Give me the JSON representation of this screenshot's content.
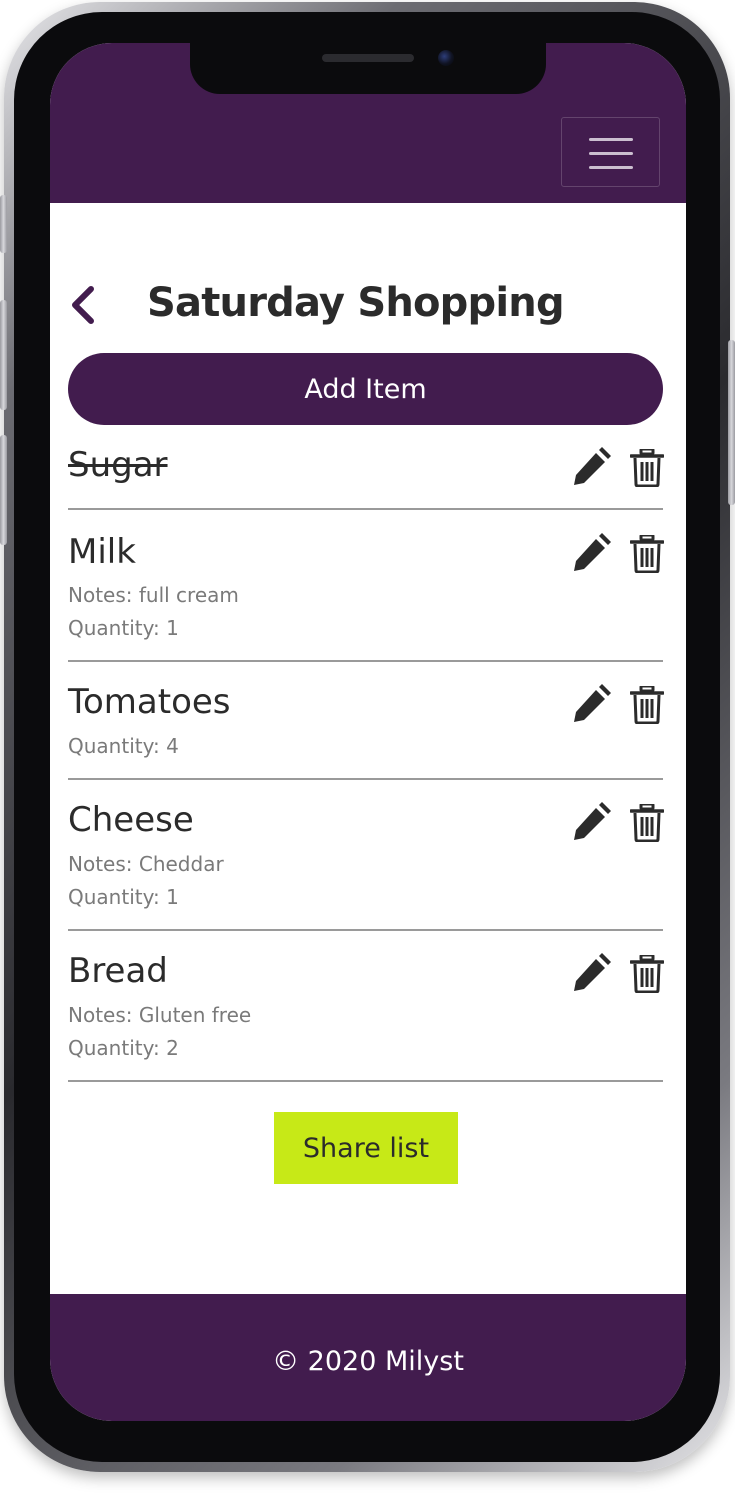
{
  "header": {
    "menu_icon": "hamburger-menu-icon",
    "background_color": "#421c4e"
  },
  "page": {
    "title": "Saturday Shopping",
    "back_icon": "chevron-left-icon"
  },
  "add_item_button": {
    "label": "Add Item"
  },
  "items": [
    {
      "name": "Sugar",
      "completed": true,
      "notes": "",
      "quantity": ""
    },
    {
      "name": "Milk",
      "completed": false,
      "notes": "Notes: full cream",
      "quantity": "Quantity: 1"
    },
    {
      "name": "Tomatoes",
      "completed": false,
      "notes": "",
      "quantity": "Quantity: 4"
    },
    {
      "name": "Cheese",
      "completed": false,
      "notes": "Notes: Cheddar",
      "quantity": "Quantity: 1"
    },
    {
      "name": "Bread",
      "completed": false,
      "notes": "Notes: Gluten free",
      "quantity": "Quantity: 2"
    }
  ],
  "item_actions": {
    "edit_icon": "pencil-icon",
    "delete_icon": "trash-icon"
  },
  "share_button": {
    "label": "Share list",
    "color": "#c7e917"
  },
  "footer": {
    "copyright": "© 2020 Milyst"
  }
}
